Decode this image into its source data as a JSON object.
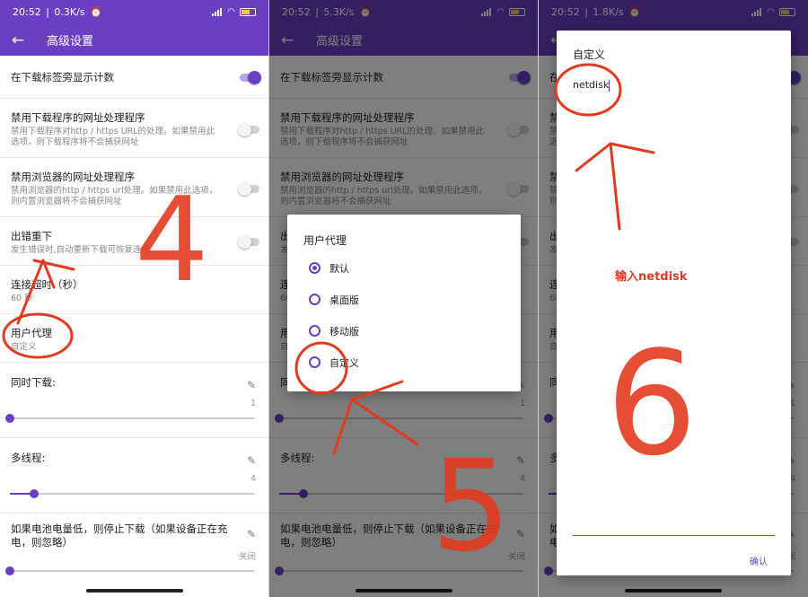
{
  "panels": [
    {
      "status": {
        "time": "20:52",
        "speed": "0.3K/s"
      }
    },
    {
      "status": {
        "time": "20:52",
        "speed": "5.3K/s"
      }
    },
    {
      "status": {
        "time": "20:52",
        "speed": "1.8K/s"
      }
    }
  ],
  "appbar": {
    "title": "高级设置"
  },
  "settings": {
    "show_count": {
      "title": "在下载标签旁显示计数"
    },
    "disable_downloader_url": {
      "title": "禁用下载程序的网址处理程序",
      "desc_1": "禁用下载程序对http / https URL的处理。如果禁用此",
      "desc_2": "选项，则下载程序将不会捕获网址"
    },
    "disable_browser_url": {
      "title": "禁用浏览器的网址处理程序",
      "desc_1": "禁用浏览器的http / https url处理。如果禁用此选项，",
      "desc_2": "则内置浏览器将不会捕获网址"
    },
    "retry_on_error": {
      "title": "出错重下",
      "desc": "发生错误时,自动重新下载可恢复连接"
    },
    "timeout": {
      "title": "连接超时（秒）",
      "value": "60 秒"
    },
    "user_agent": {
      "title": "用户代理",
      "value": "自定义"
    },
    "concurrent": {
      "title": "同时下载:",
      "value": "1",
      "fraction": 0.0
    },
    "threads": {
      "title": "多线程:",
      "value": "4",
      "fraction": 0.1
    },
    "battery": {
      "title_1": "如果电池电量低，则停止下载（如果设备正在充",
      "title_2": "电，则忽略）",
      "value": "关闭",
      "fraction": 0.0
    }
  },
  "ua_dialog": {
    "title": "用户代理",
    "options": [
      "默认",
      "桌面版",
      "移动版",
      "自定义"
    ],
    "selected": 0
  },
  "custom_dialog": {
    "title": "自定义",
    "input_value": "netdisk",
    "confirm": "确认"
  },
  "annotations": {
    "n4": "4",
    "n5": "5",
    "n6": "6",
    "hint": "输入netdisk"
  },
  "colors": {
    "accent": "#6a3fc4",
    "annotation": "#e23a1e"
  }
}
